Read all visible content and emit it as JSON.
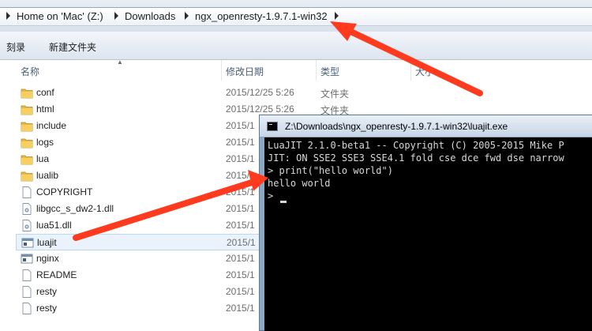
{
  "address_bar": {
    "crumbs": [
      "Home on 'Mac' (Z:)",
      "Downloads",
      "ngx_openresty-1.9.7.1-win32"
    ]
  },
  "toolbar": {
    "burn_label": "刻录",
    "new_folder_label": "新建文件夹"
  },
  "columns": {
    "name": "名称",
    "date": "修改日期",
    "type": "类型",
    "size": "大小"
  },
  "files": [
    {
      "name": "conf",
      "icon": "folder-icon",
      "date": "2015/12/25 5:26",
      "type": "文件夹"
    },
    {
      "name": "html",
      "icon": "folder-icon",
      "date": "2015/12/25 5:26",
      "type": "文件夹"
    },
    {
      "name": "include",
      "icon": "folder-icon",
      "date": "2015/1",
      "type": ""
    },
    {
      "name": "logs",
      "icon": "folder-icon",
      "date": "2015/1",
      "type": ""
    },
    {
      "name": "lua",
      "icon": "folder-icon",
      "date": "2015/1",
      "type": ""
    },
    {
      "name": "lualib",
      "icon": "folder-icon",
      "date": "2015/1",
      "type": ""
    },
    {
      "name": "COPYRIGHT",
      "icon": "file-icon",
      "date": "2015/1",
      "type": ""
    },
    {
      "name": "libgcc_s_dw2-1.dll",
      "icon": "dll-icon",
      "date": "2015/1",
      "type": ""
    },
    {
      "name": "lua51.dll",
      "icon": "dll-icon",
      "date": "2015/1",
      "type": ""
    },
    {
      "name": "luajit",
      "icon": "exe-icon",
      "date": "2015/1",
      "type": ""
    },
    {
      "name": "nginx",
      "icon": "exe-icon",
      "date": "2015/1",
      "type": ""
    },
    {
      "name": "README",
      "icon": "file-icon",
      "date": "2015/1",
      "type": ""
    },
    {
      "name": "resty",
      "icon": "file-icon",
      "date": "2015/1",
      "type": ""
    },
    {
      "name": "resty",
      "icon": "file-icon",
      "date": "2015/1",
      "type": ""
    }
  ],
  "console": {
    "title": "Z:\\Downloads\\ngx_openresty-1.9.7.1-win32\\luajit.exe",
    "lines": [
      "LuaJIT 2.1.0-beta1 -- Copyright (C) 2005-2015 Mike P",
      "JIT: ON SSE2 SSE3 SSE4.1 fold cse dce fwd dse narrow",
      "> print(\"hello world\")",
      "hello world",
      ">"
    ]
  },
  "colors": {
    "arrow": "#ff3b1f",
    "console_bg": "#000000",
    "console_text": "#d8d8d8",
    "selection": "#eaf3fc"
  }
}
